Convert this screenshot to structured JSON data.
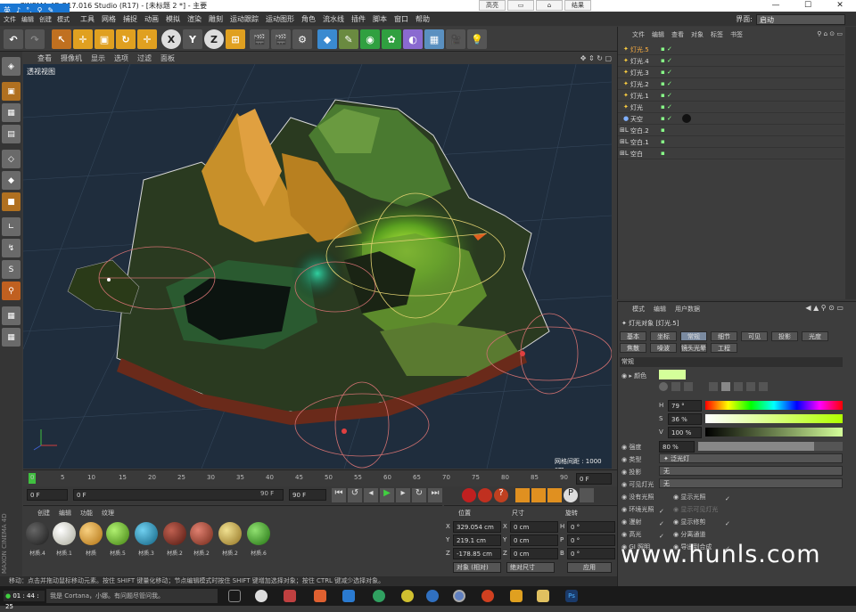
{
  "window": {
    "title": "CINEMA 4D R17.016 Studio (R17) - [未标题 2 *] - 主要",
    "min": "—",
    "max": "☐",
    "close": "✕"
  },
  "ime": {
    "lang": "英",
    "items": [
      "♪",
      "°,",
      "⚲",
      "✎"
    ]
  },
  "fixed_buttons": [
    "高亮",
    "",
    "",
    "结果"
  ],
  "menu": {
    "items": [
      "文件",
      "编辑",
      "创建",
      "模式",
      "选择",
      "工具",
      "网格",
      "捕捉",
      "动画",
      "模拟",
      "渲染",
      "雕刻",
      "运动跟踪",
      "运动图形",
      "角色",
      "流水线",
      "插件",
      "脚本",
      "窗口",
      "帮助"
    ],
    "layout_label": "界面:",
    "layout_value": "启动"
  },
  "toolbar": {
    "undo": "↶",
    "redo": "↷",
    "x": "X",
    "y": "Y",
    "z": "Z"
  },
  "viewport": {
    "menu": [
      "查看",
      "摄像机",
      "显示",
      "选项",
      "过滤",
      "面板"
    ],
    "label": "透视视图",
    "grid_label": "网格间距 : 1000 cm"
  },
  "timeline": {
    "ticks": [
      "0",
      "5",
      "10",
      "15",
      "20",
      "25",
      "30",
      "35",
      "40",
      "45",
      "50",
      "55",
      "60",
      "65",
      "70",
      "75",
      "80",
      "85",
      "90"
    ],
    "end": "0 F"
  },
  "transport": {
    "start": "0 F",
    "current": "0 F",
    "end_field": "90 F",
    "end": "90 F"
  },
  "materials": {
    "menu": [
      "创建",
      "编辑",
      "功能",
      "纹理"
    ],
    "items": [
      {
        "name": "材质.4",
        "color": "#1a1a1a"
      },
      {
        "name": "材质.1",
        "color": "#d8d8d0"
      },
      {
        "name": "材质",
        "color": "#d89a30"
      },
      {
        "name": "材质.5",
        "color": "#6ab030"
      },
      {
        "name": "材质.3",
        "color": "#2890b0"
      },
      {
        "name": "材质.2",
        "color": "#8a3020"
      },
      {
        "name": "材质.2",
        "color": "#a84a30"
      },
      {
        "name": "材质.2",
        "color": "#c8a850"
      },
      {
        "name": "材质.6",
        "color": "#40a030"
      }
    ]
  },
  "coords": {
    "headers": [
      "位置",
      "尺寸",
      "旋转"
    ],
    "rows": [
      {
        "axis": "X",
        "pos": "329.054 cm",
        "saxis": "X",
        "size": "0 cm",
        "raxis": "H",
        "rot": "0 °"
      },
      {
        "axis": "Y",
        "pos": "219.1 cm",
        "saxis": "Y",
        "size": "0 cm",
        "raxis": "P",
        "rot": "0 °"
      },
      {
        "axis": "Z",
        "pos": "-178.85 cm",
        "saxis": "Z",
        "size": "0 cm",
        "raxis": "B",
        "rot": "0 °"
      }
    ],
    "mode": "对象 (相对)",
    "size_mode": "绝对尺寸",
    "apply": "应用"
  },
  "object_manager": {
    "menu": [
      "文件",
      "编辑",
      "查看",
      "对象",
      "标签",
      "书签"
    ],
    "objects": [
      {
        "name": "灯光.5",
        "sel": true
      },
      {
        "name": "灯光.4",
        "sel": false
      },
      {
        "name": "灯光.3",
        "sel": false
      },
      {
        "name": "灯光.2",
        "sel": false
      },
      {
        "name": "灯光.1",
        "sel": false
      },
      {
        "name": "灯光",
        "sel": false
      },
      {
        "name": "天空",
        "sel": false
      },
      {
        "name": "空白.2",
        "sel": false
      },
      {
        "name": "空白.1",
        "sel": false
      },
      {
        "name": "空白",
        "sel": false
      }
    ]
  },
  "attributes": {
    "menu": [
      "模式",
      "编辑",
      "用户数据"
    ],
    "title": "灯光对象 [灯光.5]",
    "tabs_row1": [
      "基本",
      "坐标",
      "常规",
      "细节",
      "可见",
      "投影",
      "光度"
    ],
    "tabs_row2": [
      "焦散",
      "噪波",
      "镜头光晕",
      "工程"
    ],
    "section": "常规",
    "color_label": "颜色",
    "h_label": "H",
    "h_value": "79 °",
    "s_label": "S",
    "s_value": "36 %",
    "v_label": "V",
    "v_value": "100 %",
    "intensity_label": "强度",
    "intensity_value": "80 %",
    "type_label": "类型",
    "type_value": "泛光灯",
    "shadow_label": "投影",
    "shadow_value": "无",
    "visible_label": "可见灯光",
    "visible_value": "无",
    "checks_left": [
      "没有光照",
      "环境光照",
      "漫射",
      "高光",
      "GI 照明"
    ],
    "checks_right": [
      "显示光照",
      "显示可见灯光",
      "显示修剪",
      "分离通道",
      "导出到合成"
    ]
  },
  "status": "移动：点击并拖动鼠标移动元素。按住 SHIFT 键量化移动；节点编辑模式时按住 SHIFT 键增加选择对象；按住 CTRL 键减少选择对象。",
  "taskbar": {
    "time": "01 : 44 : 25",
    "cortana": "我是 Cortana，小娜。有问题尽管问我。"
  },
  "watermark": "www.hunls.com",
  "brand": "MAXON CINEMA 4D"
}
